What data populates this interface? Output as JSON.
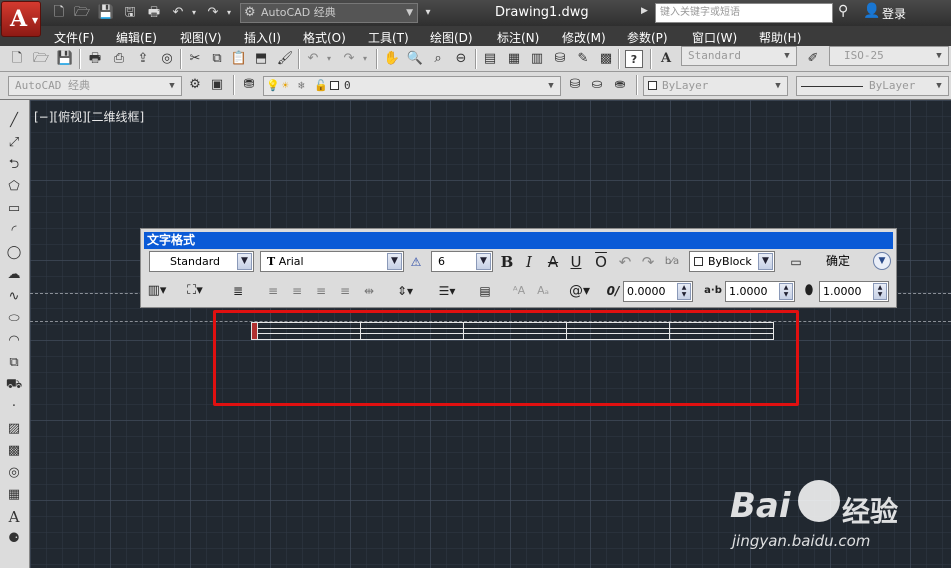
{
  "titlebar": {
    "app_letter": "A",
    "workspace": "AutoCAD 经典",
    "document": "Drawing1.dwg",
    "search_placeholder": "键入关键字或短语",
    "login": "登录"
  },
  "menu": [
    "文件(F)",
    "编辑(E)",
    "视图(V)",
    "插入(I)",
    "格式(O)",
    "工具(T)",
    "绘图(D)",
    "标注(N)",
    "修改(M)",
    "参数(P)",
    "窗口(W)",
    "帮助(H)"
  ],
  "toolbar1": {
    "text_style": "Standard",
    "dim_style": "ISO-25"
  },
  "toolbar2": {
    "workspace": "AutoCAD 经典",
    "layer": "0",
    "color": "ByLayer",
    "linetype": "ByLayer"
  },
  "viewport": {
    "label": "[−][俯视][二维线框]"
  },
  "text_format": {
    "title": "文字格式",
    "style": "Standard",
    "font": "Arial",
    "height": "6",
    "color": "ByBlock",
    "ok_label": "确定",
    "oblique": "0.0000",
    "tracking": "1.0000",
    "width_factor": "1.0000",
    "icons": {
      "bold": "B",
      "italic": "I",
      "strike": "A",
      "underline": "U",
      "overline": "O",
      "font_prefix": "T",
      "oblique_symbol": "0/",
      "tracking_symbol": "a·b",
      "symbol_at": "@"
    }
  },
  "watermark": {
    "brand_left": "Bai",
    "brand_right": "经验",
    "url": "jingyan.baidu.com"
  }
}
